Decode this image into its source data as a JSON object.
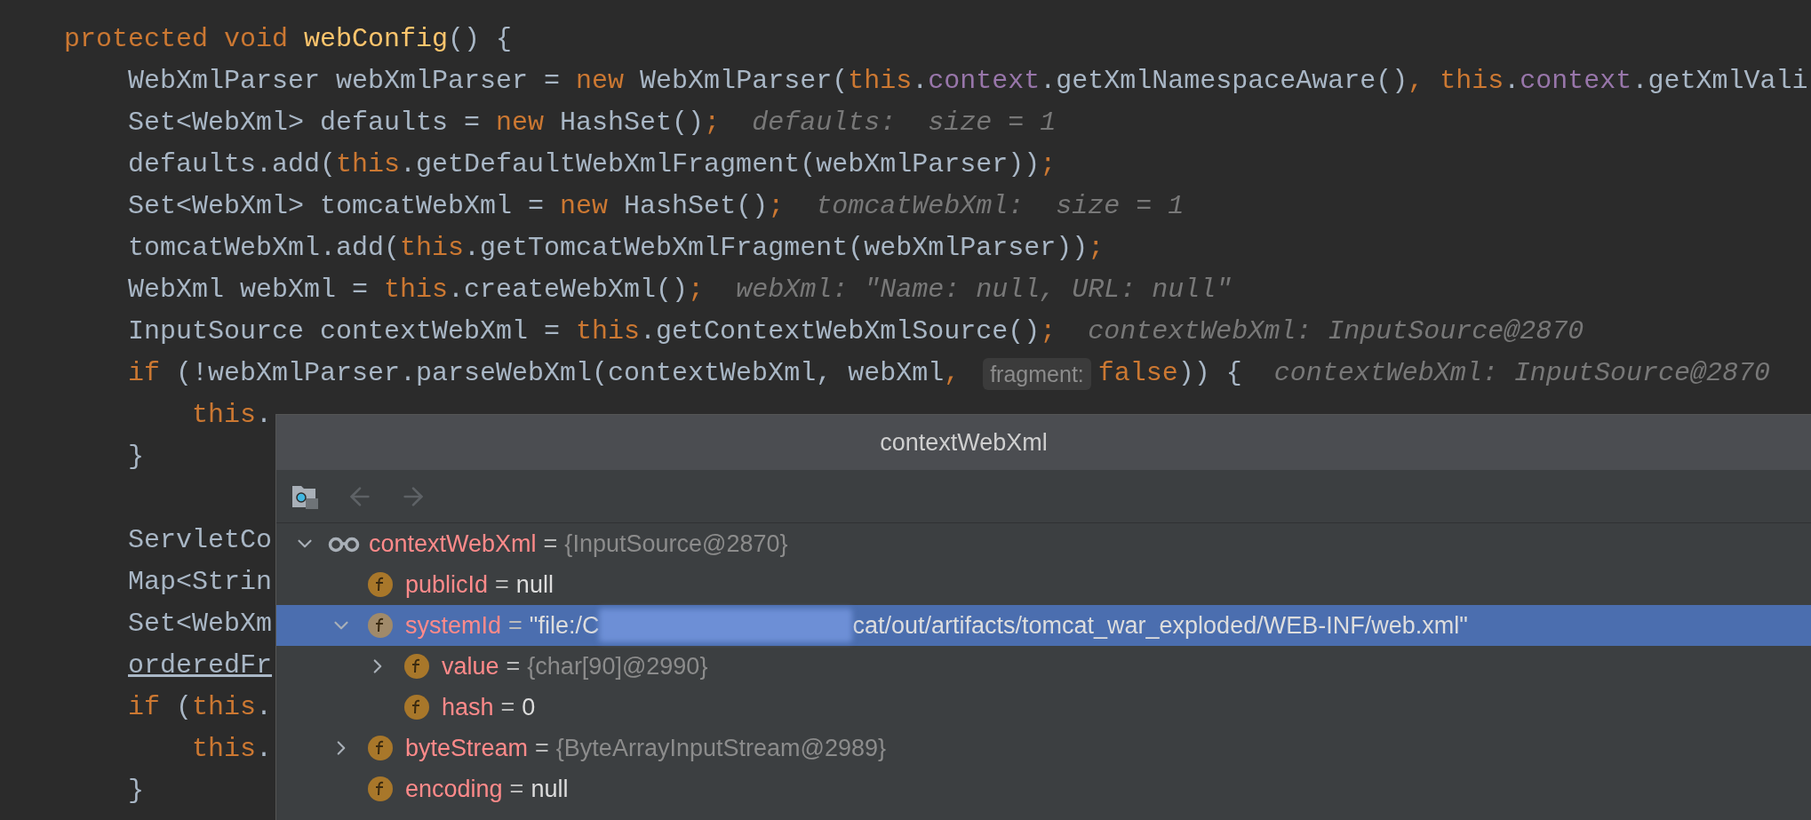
{
  "editor": {
    "lines": [
      {
        "kind": "code",
        "tokens": [
          {
            "kind": "kw",
            "t": "protected void "
          },
          {
            "kind": "decl",
            "t": "webConfig"
          },
          {
            "kind": "txt",
            "t": "() {"
          }
        ],
        "children": [
          {
            "kind": "code",
            "tokens": [
              {
                "kind": "txt",
                "t": "WebXmlParser webXmlParser = "
              },
              {
                "kind": "kw",
                "t": "new "
              },
              {
                "kind": "txt",
                "t": "WebXmlParser("
              },
              {
                "kind": "kw",
                "t": "this"
              },
              {
                "kind": "txt",
                "t": "."
              },
              {
                "kind": "field",
                "t": "context"
              },
              {
                "kind": "txt",
                "t": ".getXmlNamespaceAware()"
              },
              {
                "kind": "kw",
                "t": ", this"
              },
              {
                "kind": "txt",
                "t": "."
              },
              {
                "kind": "field",
                "t": "context"
              },
              {
                "kind": "txt",
                "t": ".getXmlVali"
              }
            ]
          },
          {
            "kind": "code",
            "tokens": [
              {
                "kind": "txt",
                "t": "Set<WebXml> defaults = "
              },
              {
                "kind": "kw",
                "t": "new "
              },
              {
                "kind": "txt",
                "t": "HashSet()"
              },
              {
                "kind": "kw",
                "t": ";"
              },
              {
                "kind": "hint",
                "t": "  defaults:  size = 1"
              }
            ]
          },
          {
            "kind": "code",
            "tokens": [
              {
                "kind": "txt",
                "t": "defaults.add("
              },
              {
                "kind": "kw",
                "t": "this"
              },
              {
                "kind": "txt",
                "t": ".getDefaultWebXmlFragment(webXmlParser))"
              },
              {
                "kind": "kw",
                "t": ";"
              }
            ]
          },
          {
            "kind": "code",
            "tokens": [
              {
                "kind": "txt",
                "t": "Set<WebXml> tomcatWebXml = "
              },
              {
                "kind": "kw",
                "t": "new "
              },
              {
                "kind": "txt",
                "t": "HashSet()"
              },
              {
                "kind": "kw",
                "t": ";"
              },
              {
                "kind": "hint",
                "t": "  tomcatWebXml:  size = 1"
              }
            ]
          },
          {
            "kind": "code",
            "tokens": [
              {
                "kind": "txt",
                "t": "tomcatWebXml.add("
              },
              {
                "kind": "kw",
                "t": "this"
              },
              {
                "kind": "txt",
                "t": ".getTomcatWebXmlFragment(webXmlParser))"
              },
              {
                "kind": "kw",
                "t": ";"
              }
            ]
          },
          {
            "kind": "code",
            "tokens": [
              {
                "kind": "txt",
                "t": "WebXml webXml = "
              },
              {
                "kind": "kw",
                "t": "this"
              },
              {
                "kind": "txt",
                "t": ".createWebXml()"
              },
              {
                "kind": "kw",
                "t": ";"
              },
              {
                "kind": "hint",
                "t": "  webXml: \"Name: null, URL: null\""
              }
            ]
          },
          {
            "kind": "code",
            "tokens": [
              {
                "kind": "txt",
                "t": "InputSource contextWebXml = "
              },
              {
                "kind": "kw",
                "t": "this"
              },
              {
                "kind": "txt",
                "t": ".getContextWebXmlSource()"
              },
              {
                "kind": "kw",
                "t": ";"
              },
              {
                "kind": "hint",
                "t": "  contextWebXml: InputSource@2870"
              }
            ]
          },
          {
            "kind": "code",
            "tokens": [
              {
                "kind": "kw",
                "t": "if "
              },
              {
                "kind": "txt",
                "t": "(!webXmlParser.parseWebXml(contextWebXml, webXml"
              },
              {
                "kind": "kw",
                "t": ", "
              },
              {
                "kind": "chip",
                "t": "fragment:"
              },
              {
                "kind": "kw",
                "t": "false"
              },
              {
                "kind": "txt",
                "t": ")) {"
              },
              {
                "kind": "hint",
                "t": "  contextWebXml: InputSource@2870"
              }
            ],
            "children": [
              {
                "kind": "code",
                "tokens": [
                  {
                    "kind": "kw",
                    "t": "this"
                  },
                  {
                    "kind": "txt",
                    "t": "."
                  }
                ]
              }
            ]
          },
          {
            "kind": "code",
            "tokens": [
              {
                "kind": "txt",
                "t": "}"
              }
            ]
          },
          {
            "kind": "blank"
          },
          {
            "kind": "code",
            "tokens": [
              {
                "kind": "txt",
                "t": "ServletCo"
              }
            ]
          },
          {
            "kind": "code",
            "tokens": [
              {
                "kind": "txt",
                "t": "Map<Strin"
              }
            ]
          },
          {
            "kind": "code",
            "tokens": [
              {
                "kind": "txt",
                "t": "Set<WebXm"
              }
            ]
          },
          {
            "kind": "code",
            "tokens": [
              {
                "kind": "reassigned",
                "t": "orderedFr"
              }
            ]
          },
          {
            "kind": "code",
            "tokens": [
              {
                "kind": "kw",
                "t": "if "
              },
              {
                "kind": "txt",
                "t": "("
              },
              {
                "kind": "kw",
                "t": "this"
              },
              {
                "kind": "txt",
                "t": "."
              }
            ],
            "children": [
              {
                "kind": "code",
                "tokens": [
                  {
                    "kind": "kw",
                    "t": "this"
                  },
                  {
                    "kind": "txt",
                    "t": "."
                  }
                ]
              }
            ]
          },
          {
            "kind": "code",
            "tokens": [
              {
                "kind": "txt",
                "t": "}"
              }
            ]
          }
        ]
      }
    ]
  },
  "popup": {
    "title": "contextWebXml",
    "toolbar": [
      {
        "kind": "tree",
        "disabled": false
      },
      {
        "kind": "back",
        "disabled": true
      },
      {
        "kind": "forward",
        "disabled": true
      }
    ],
    "tree": [
      {
        "kind": "watch",
        "name": "contextWebXml",
        "sep": "=",
        "value": "{InputSource@2870}",
        "reference": true,
        "expanded": true,
        "selected": false,
        "children": [
          {
            "kind": "field",
            "name": "publicId",
            "sep": "=",
            "value": "null",
            "reference": false,
            "selected": false
          },
          {
            "kind": "field",
            "name": "systemId",
            "sep": "=",
            "value": "\"file:/C",
            "value_tail": "cat/out/artifacts/tomcat_war_exploded/WEB-INF/web.xml\"",
            "redacted": true,
            "reference": false,
            "expanded": true,
            "selected": true,
            "children": [
              {
                "kind": "field",
                "name": "value",
                "sep": "=",
                "value": "{char[90]@2990}",
                "reference": true,
                "expanded": false,
                "selected": false
              },
              {
                "kind": "field",
                "name": "hash",
                "sep": "=",
                "value": "0",
                "reference": false,
                "selected": false
              }
            ]
          },
          {
            "kind": "field",
            "name": "byteStream",
            "sep": "=",
            "value": "{ByteArrayInputStream@2989}",
            "reference": true,
            "expanded": false,
            "selected": false
          },
          {
            "kind": "field",
            "name": "encoding",
            "sep": "=",
            "value": "null",
            "reference": false,
            "selected": false
          }
        ]
      }
    ]
  }
}
